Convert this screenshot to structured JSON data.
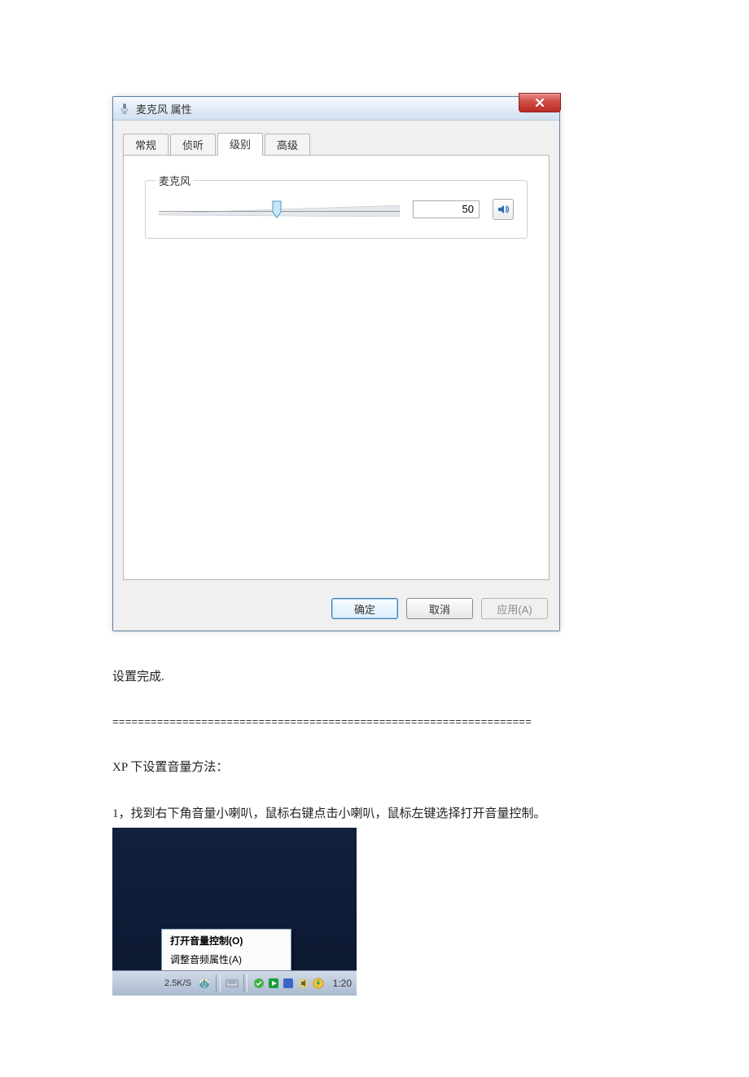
{
  "dialog": {
    "title": "麦克风 属性",
    "tabs": [
      "常规",
      "侦听",
      "级别",
      "高级"
    ],
    "active_tab_index": 2,
    "group_label": "麦克风",
    "slider_value": "50",
    "buttons": {
      "ok": "确定",
      "cancel": "取消",
      "apply": "应用(A)"
    }
  },
  "text": {
    "done": "设置完成.",
    "divider": "==================================================================",
    "xp_heading": "XP 下设置音量方法：",
    "xp_step1": "1，找到右下角音量小喇叭，鼠标右键点击小喇叭，鼠标左键选择打开音量控制。"
  },
  "xp": {
    "menu_item_1": "打开音量控制(O)",
    "menu_item_2": "调整音频属性(A)",
    "speed": "2.5K/S",
    "clock": "1:20"
  }
}
